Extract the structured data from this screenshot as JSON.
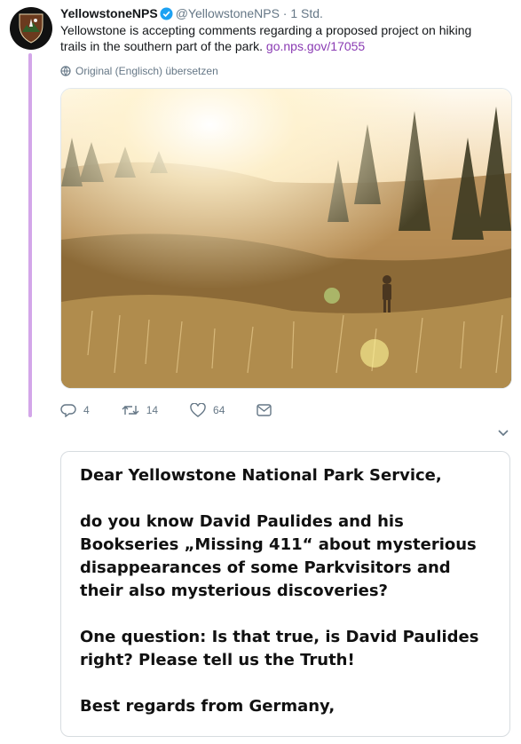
{
  "tweet": {
    "author_name": "YellowstoneNPS",
    "handle": "@YellowstoneNPS",
    "separator": "·",
    "time": "1 Std.",
    "text": "Yellowstone is accepting comments regarding a proposed project on hiking trails in the southern part of the park.",
    "link_text": "go.nps.gov/17055",
    "translate_label": "Original (Englisch) übersetzen",
    "reply_count": "4",
    "retweet_count": "14",
    "like_count": "64",
    "colors": {
      "thread_line": "#d3a6e9",
      "link": "#8a3bb3",
      "verified": "#1da1f2"
    }
  },
  "reply_card": {
    "paragraphs": [
      "Dear Yellowstone National Park Service,",
      "do you know David Paulides and his Bookseries „Missing 411“ about mysterious disappearances of some Parkvisitors and their also mysterious discoveries?",
      "One question: Is that true, is David Paulides right? Please tell us the Truth!",
      "Best regards from Germany,"
    ]
  },
  "icons": [
    "park-service-logo",
    "verified-icon",
    "globe-icon",
    "reply-icon",
    "retweet-icon",
    "like-icon",
    "message-icon",
    "chevron-down-icon"
  ]
}
